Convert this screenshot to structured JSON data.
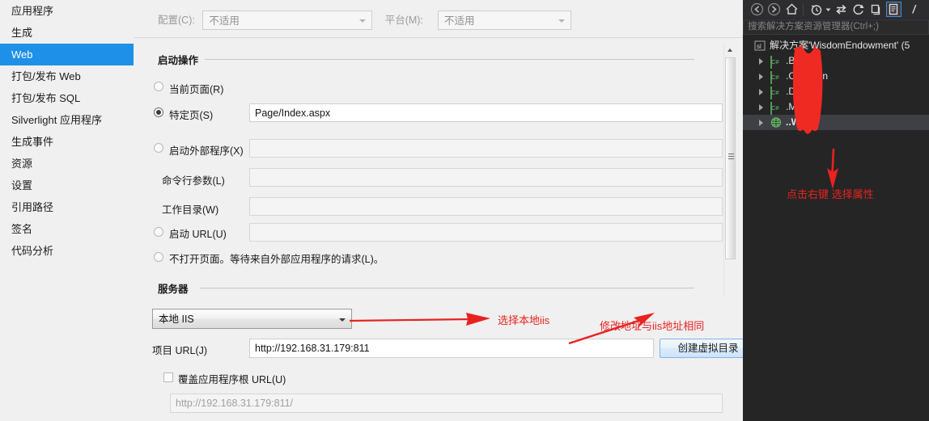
{
  "sidebar": {
    "items": [
      {
        "label": "应用程序",
        "selected": false
      },
      {
        "label": "生成",
        "selected": false
      },
      {
        "label": "Web",
        "selected": true
      },
      {
        "label": "打包/发布 Web",
        "selected": false
      },
      {
        "label": "打包/发布 SQL",
        "selected": false
      },
      {
        "label": "Silverlight 应用程序",
        "selected": false
      },
      {
        "label": "生成事件",
        "selected": false
      },
      {
        "label": "资源",
        "selected": false
      },
      {
        "label": "设置",
        "selected": false
      },
      {
        "label": "引用路径",
        "selected": false
      },
      {
        "label": "签名",
        "selected": false
      },
      {
        "label": "代码分析",
        "selected": false
      }
    ]
  },
  "config_bar": {
    "configuration_label": "配置(C):",
    "configuration_value": "不适用",
    "platform_label": "平台(M):",
    "platform_value": "不适用"
  },
  "start_action": {
    "group_title": "启动操作",
    "options": [
      {
        "label": "当前页面(R)",
        "mnemonic": "R",
        "checked": false
      },
      {
        "label": "特定页(S)",
        "mnemonic": "S",
        "checked": true
      },
      {
        "label": "启动外部程序(X)",
        "mnemonic": "X",
        "checked": false
      },
      {
        "label": "启动 URL(U)",
        "mnemonic": "U",
        "checked": false
      },
      {
        "label": "不打开页面。等待来自外部应用程序的请求(L)。",
        "mnemonic": "L",
        "checked": false
      }
    ],
    "specific_page_value": "Page/Index.aspx",
    "external_program_value": "",
    "command_line_args_label": "命令行参数(L)",
    "command_line_args_value": "",
    "working_dir_label": "工作目录(W)",
    "working_dir_value": "",
    "start_url_value": ""
  },
  "server": {
    "group_title": "服务器",
    "server_type_value": "本地 IIS",
    "project_url_label": "项目 URL(J)",
    "project_url_value": "http://192.168.31.179:811",
    "create_virtual_dir_button": "创建虚拟目录",
    "override_root_url_label": "覆盖应用程序根 URL(U)",
    "override_root_url_checked": false,
    "override_root_url_value": "http://192.168.31.179:811/"
  },
  "solution_explorer": {
    "search_placeholder": "搜索解决方案资源管理器(Ctrl+;)",
    "toolbar_icons": [
      "back-icon",
      "forward-icon",
      "home-icon",
      "pending-changes-icon",
      "dropdown-icon",
      "sync-with-active-document-icon",
      "refresh-icon",
      "collapse-all-icon",
      "show-all-files-icon",
      "properties-icon"
    ],
    "tree": [
      {
        "label": "解决方案'WisdomEndowment' (5",
        "icon": "solution-icon",
        "level": 0,
        "selected": false,
        "bold": false
      },
      {
        "label": ".BLL",
        "icon": "csharp-project-icon",
        "level": 1,
        "selected": false,
        "bold": false
      },
      {
        "label": ".Common",
        "icon": "csharp-project-icon",
        "level": 1,
        "selected": false,
        "bold": false
      },
      {
        "label": ".DAL",
        "icon": "csharp-project-icon",
        "level": 1,
        "selected": false,
        "bold": false
      },
      {
        "label": ".Model",
        "icon": "csharp-project-icon",
        "level": 1,
        "selected": false,
        "bold": false
      },
      {
        "label": "..Web",
        "icon": "web-project-icon",
        "level": 1,
        "selected": true,
        "bold": true
      }
    ]
  },
  "annotations": {
    "select_local_iis": "选择本地iis",
    "modify_address": "修改地址与iis地址相同",
    "right_click_properties": "点击右键 选择属性"
  },
  "colors": {
    "accent": "#1e90e8",
    "annotation_red": "#e8231f",
    "panel_bg": "#252526",
    "toolbar_bg": "#2d2d30"
  }
}
